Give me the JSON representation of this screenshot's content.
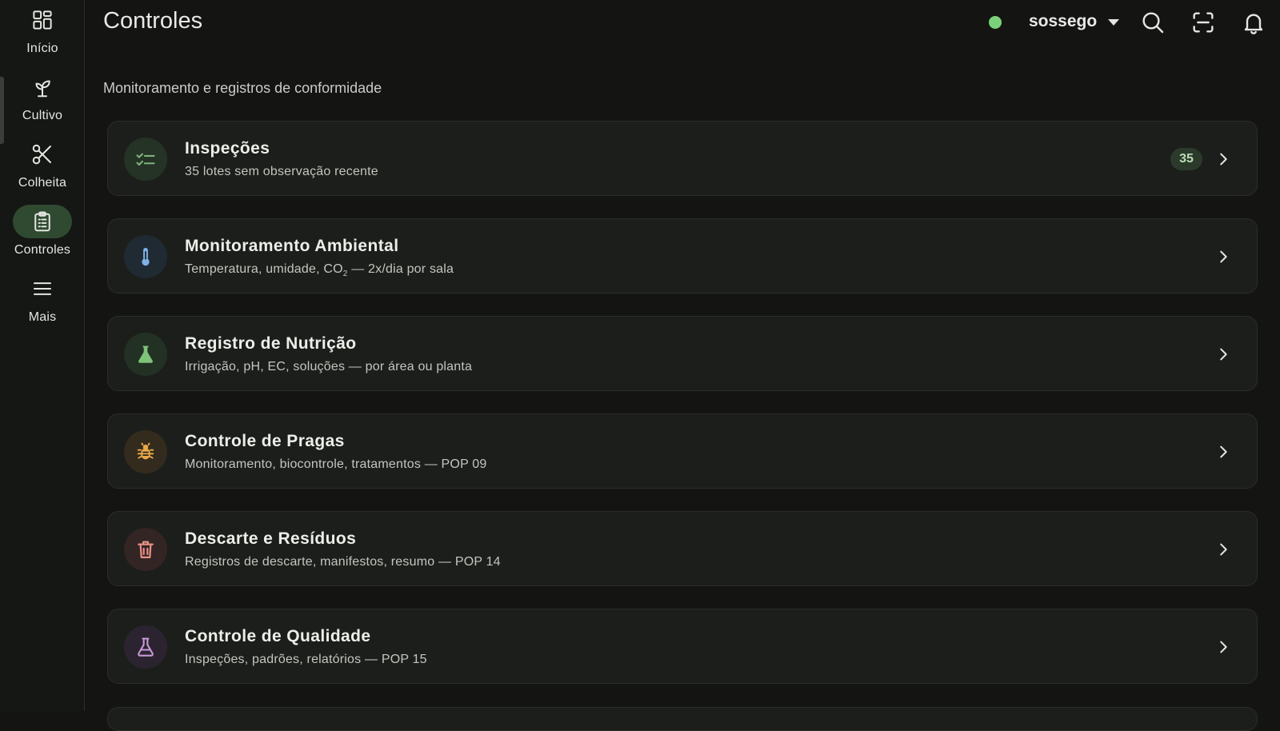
{
  "nav": {
    "items": [
      {
        "label": "Início",
        "icon": "dashboard-icon"
      },
      {
        "label": "Cultivo",
        "icon": "sprout-icon"
      },
      {
        "label": "Colheita",
        "icon": "scissors-icon"
      },
      {
        "label": "Controles",
        "icon": "clipboard-list-icon",
        "active": true
      },
      {
        "label": "Mais",
        "icon": "menu-icon"
      }
    ]
  },
  "header": {
    "title": "Controles",
    "status_color": "#7bd17a",
    "user": "sossego",
    "actions": [
      "search-icon",
      "scan-icon",
      "bell-icon"
    ]
  },
  "main": {
    "subtitle": "Monitoramento e registros de conformidade",
    "cards": [
      {
        "title": "Inspeções",
        "description": "35 lotes sem observação recente",
        "badge": "35",
        "icon": "checklist-icon",
        "color": "#7fb37c"
      },
      {
        "title": "Monitoramento Ambiental",
        "description_pre": "Temperatura, umidade, CO",
        "description_sub": "2",
        "description_post": " — 2x/dia por sala",
        "icon": "thermometer-icon",
        "color": "#7fb0e8"
      },
      {
        "title": "Registro de Nutrição",
        "description": "Irrigação, pH, EC, soluções — por área ou planta",
        "icon": "flask-icon",
        "color": "#7fc27a"
      },
      {
        "title": "Controle de Pragas",
        "description": "Monitoramento, biocontrole, tratamentos — POP 09",
        "icon": "bug-icon",
        "color": "#e9a94a"
      },
      {
        "title": "Descarte e Resíduos",
        "description": "Registros de descarte, manifestos, resumo — POP 14",
        "icon": "trash-icon",
        "color": "#e88f86"
      },
      {
        "title": "Controle de Qualidade",
        "description": "Inspeções, padrões, relatórios — POP 15",
        "icon": "beaker-outline-icon",
        "color": "#c99ad8"
      }
    ]
  }
}
